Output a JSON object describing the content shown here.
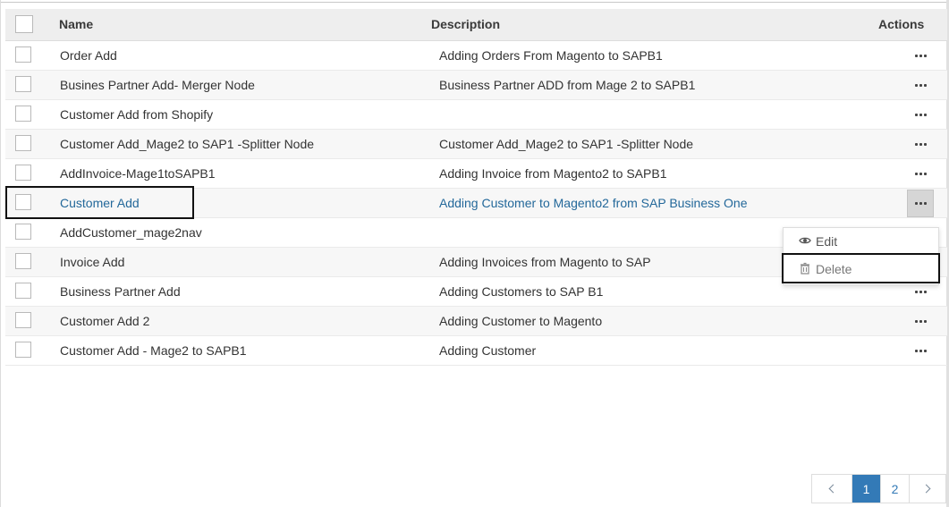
{
  "table": {
    "headers": {
      "name": "Name",
      "description": "Description",
      "actions": "Actions"
    },
    "rows": [
      {
        "name": "Order Add",
        "description": "Adding Orders From Magento to SAPB1"
      },
      {
        "name": "Busines Partner Add- Merger Node",
        "description": "Business Partner ADD from Mage 2 to SAPB1"
      },
      {
        "name": "Customer Add from Shopify",
        "description": ""
      },
      {
        "name": "Customer Add_Mage2 to SAP1 -Splitter Node",
        "description": "Customer Add_Mage2 to SAP1 -Splitter Node"
      },
      {
        "name": "AddInvoice-Mage1toSAPB1",
        "description": "Adding Invoice from Magento2 to SAPB1"
      },
      {
        "name": "Customer Add",
        "description": "Adding Customer to Magento2 from SAP Business One"
      },
      {
        "name": "AddCustomer_mage2nav",
        "description": ""
      },
      {
        "name": "Invoice Add",
        "description": "Adding Invoices from Magento to SAP"
      },
      {
        "name": "Business Partner Add",
        "description": "Adding Customers to SAP B1"
      },
      {
        "name": "Customer Add 2",
        "description": "Adding Customer to Magento"
      },
      {
        "name": "Customer Add - Mage2 to SAPB1",
        "description": "Adding Customer"
      }
    ]
  },
  "actions_menu": {
    "edit_label": "Edit",
    "edit_icon": "eye-icon",
    "delete_label": "Delete",
    "delete_icon": "trash-icon"
  },
  "pagination": {
    "pages": [
      "1",
      "2"
    ],
    "current": "1"
  },
  "colors": {
    "link": "#23689a",
    "pagination_active": "#337ab7"
  }
}
